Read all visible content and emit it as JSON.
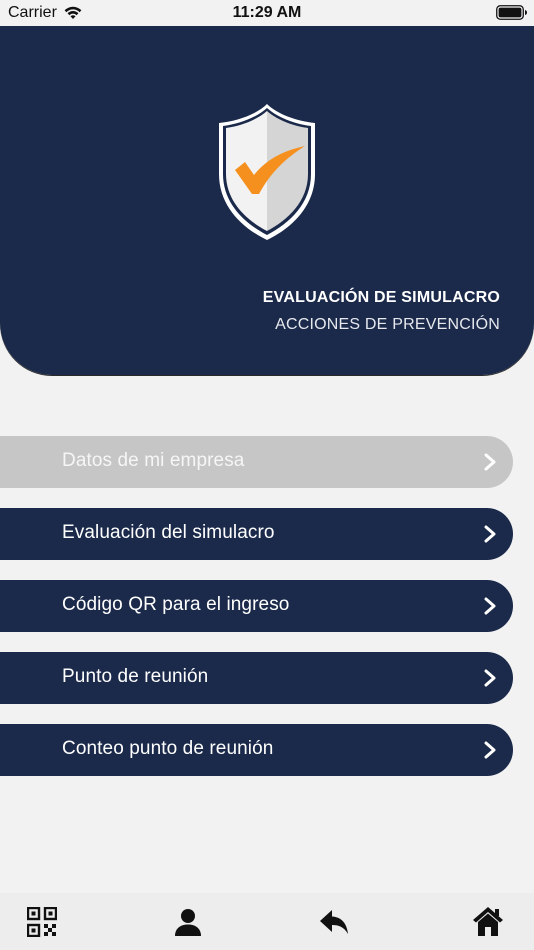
{
  "status_bar": {
    "carrier": "Carrier",
    "time": "11:29 AM"
  },
  "header": {
    "title": "EVALUACIÓN DE SIMULACRO",
    "subtitle": "ACCIONES DE PREVENCIÓN",
    "background_color": "#1b2a4a",
    "logo_icon": "shield-check-icon",
    "check_color": "#f5901e"
  },
  "menu": {
    "items": [
      {
        "label": "Datos de mi empresa",
        "enabled": false
      },
      {
        "label": "Evaluación del simulacro",
        "enabled": true
      },
      {
        "label": "Código QR para el ingreso",
        "enabled": true
      },
      {
        "label": "Punto de reunión",
        "enabled": true
      },
      {
        "label": "Conteo punto de reunión",
        "enabled": true
      }
    ],
    "enabled_color": "#1b2a4a",
    "disabled_color": "#c6c6c6",
    "chevron_icon": "chevron-right-icon"
  },
  "tabbar": {
    "tabs": [
      {
        "icon": "qr-code-icon"
      },
      {
        "icon": "user-icon"
      },
      {
        "icon": "reply-icon"
      },
      {
        "icon": "home-icon"
      }
    ]
  }
}
